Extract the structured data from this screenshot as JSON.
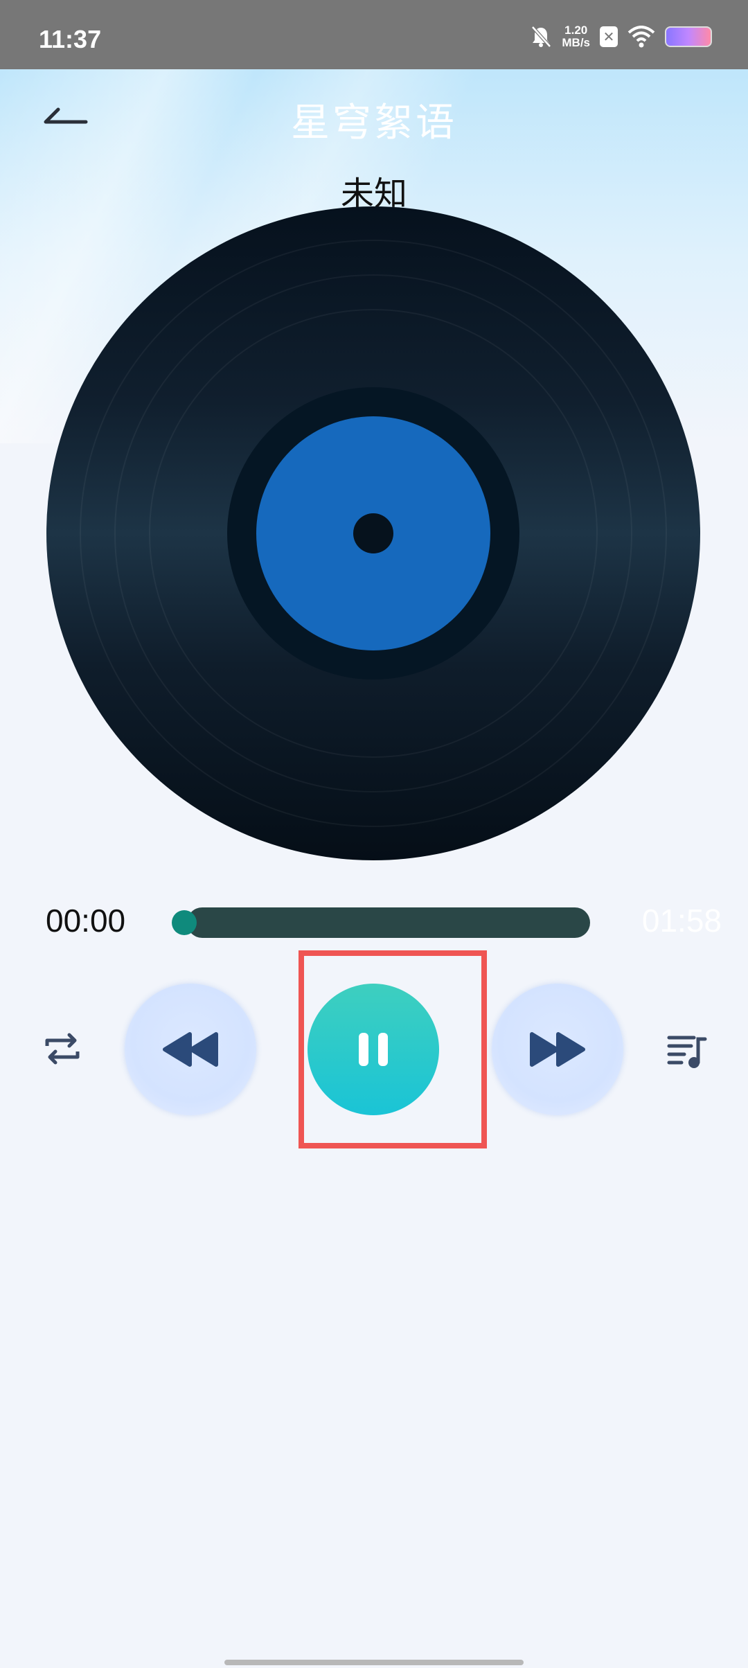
{
  "status_bar": {
    "time": "11:37",
    "net_speed_value": "1.20",
    "net_speed_unit": "MB/s",
    "icons": [
      "bell-muted-icon",
      "x-badge-icon",
      "wifi-icon",
      "battery-icon"
    ]
  },
  "header": {
    "title": "星穹絮语",
    "back_icon": "back-arrow-icon"
  },
  "song": {
    "name": "未知"
  },
  "player": {
    "current_time": "00:00",
    "total_time": "01:58",
    "progress": 0.0,
    "state": "playing"
  },
  "controls": {
    "repeat_icon": "repeat-icon",
    "prev_icon": "rewind-icon",
    "play_pause_icon": "pause-icon",
    "next_icon": "fast-forward-icon",
    "playlist_icon": "playlist-icon"
  },
  "colors": {
    "accent": "#1ac4d6",
    "disc_label": "#1669bd",
    "highlight": "#ef5553"
  }
}
